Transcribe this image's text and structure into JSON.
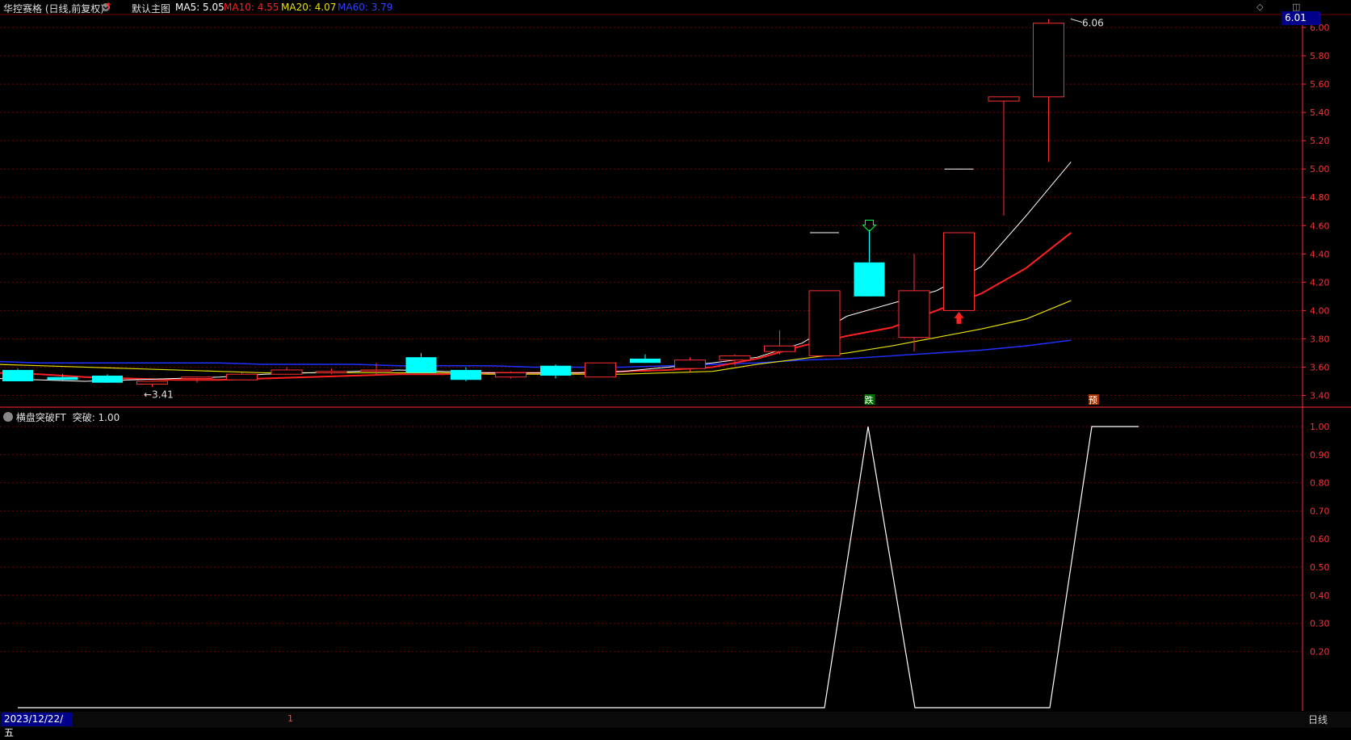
{
  "header": {
    "stock_name": "华控赛格 (日线,前复权)",
    "template_name": "默认主图",
    "ma_labels": [
      {
        "text": "MA5: 5.05",
        "color": "#ffffff"
      },
      {
        "text": "MA10: 4.55",
        "color": "#ff2020"
      },
      {
        "text": "MA20: 4.07",
        "color": "#e8e000"
      },
      {
        "text": "MA60: 3.79",
        "color": "#3040ff"
      }
    ]
  },
  "price_axis": {
    "ticks": [
      "6.00",
      "5.80",
      "5.60",
      "5.40",
      "5.20",
      "5.00",
      "4.80",
      "4.60",
      "4.40",
      "4.20",
      "4.00",
      "3.80",
      "3.60",
      "3.40"
    ],
    "tick_values": [
      6.0,
      5.8,
      5.6,
      5.4,
      5.2,
      5.0,
      4.8,
      4.6,
      4.4,
      4.2,
      4.0,
      3.8,
      3.6,
      3.4
    ],
    "current_price": "6.01"
  },
  "annotations": {
    "low_label": "←3.41",
    "high_label": "6.06",
    "signal_down_text": "跌",
    "signal_up_text": "预"
  },
  "indicator": {
    "title": "横盘突破FT",
    "value_label": "突破: 1.00",
    "ticks": [
      "1.00",
      "0.90",
      "0.80",
      "0.70",
      "0.60",
      "0.50",
      "0.40",
      "0.30",
      "0.20"
    ],
    "tick_values": [
      1.0,
      0.9,
      0.8,
      0.7,
      0.6,
      0.5,
      0.4,
      0.3,
      0.2
    ]
  },
  "footer": {
    "date": "2023/12/22/五",
    "marker": "1",
    "period": "日线"
  },
  "colors": {
    "up": "#ff3030",
    "down": "#00ffff",
    "grid": "#7a0000",
    "ma5": "#ffffff",
    "ma10": "#ff2020",
    "ma20": "#e8e000",
    "ma60": "#2030ff"
  },
  "chart_data": {
    "type": "candlestick",
    "candles": [
      {
        "o": 3.58,
        "h": 3.59,
        "l": 3.5,
        "c": 3.5
      },
      {
        "o": 3.53,
        "h": 3.55,
        "l": 3.5,
        "c": 3.51
      },
      {
        "o": 3.54,
        "h": 3.55,
        "l": 3.49,
        "c": 3.49
      },
      {
        "o": 3.48,
        "h": 3.5,
        "l": 3.46,
        "c": 3.5
      },
      {
        "o": 3.52,
        "h": 3.53,
        "l": 3.49,
        "c": 3.53
      },
      {
        "o": 3.51,
        "h": 3.56,
        "l": 3.51,
        "c": 3.55
      },
      {
        "o": 3.55,
        "h": 3.6,
        "l": 3.55,
        "c": 3.58
      },
      {
        "o": 3.56,
        "h": 3.59,
        "l": 3.55,
        "c": 3.57
      },
      {
        "o": 3.58,
        "h": 3.63,
        "l": 3.55,
        "c": 3.58
      },
      {
        "o": 3.67,
        "h": 3.7,
        "l": 3.56,
        "c": 3.56
      },
      {
        "o": 3.58,
        "h": 3.6,
        "l": 3.5,
        "c": 3.51
      },
      {
        "o": 3.53,
        "h": 3.57,
        "l": 3.52,
        "c": 3.56
      },
      {
        "o": 3.61,
        "h": 3.62,
        "l": 3.52,
        "c": 3.54
      },
      {
        "o": 3.53,
        "h": 3.63,
        "l": 3.53,
        "c": 3.63
      },
      {
        "o": 3.66,
        "h": 3.69,
        "l": 3.63,
        "c": 3.63
      },
      {
        "o": 3.59,
        "h": 3.67,
        "l": 3.57,
        "c": 3.65
      },
      {
        "o": 3.65,
        "h": 3.69,
        "l": 3.61,
        "c": 3.68
      },
      {
        "o": 3.71,
        "h": 3.86,
        "l": 3.69,
        "c": 3.75
      },
      {
        "o": 3.68,
        "h": 4.14,
        "l": 3.68,
        "c": 4.14
      },
      {
        "o": 4.34,
        "h": 4.57,
        "l": 4.1,
        "c": 4.1
      },
      {
        "o": 3.81,
        "h": 4.4,
        "l": 3.71,
        "c": 4.14
      },
      {
        "o": 4.0,
        "h": 4.55,
        "l": 4.0,
        "c": 4.55
      },
      {
        "o": 5.48,
        "h": 5.51,
        "l": 4.67,
        "c": 5.51
      },
      {
        "o": 5.51,
        "h": 6.06,
        "l": 5.05,
        "c": 6.03
      }
    ],
    "ma5": [
      3.52,
      3.51,
      3.5,
      3.51,
      3.52,
      3.53,
      3.55,
      3.56,
      3.57,
      3.58,
      3.57,
      3.56,
      3.56,
      3.56,
      3.57,
      3.6,
      3.63,
      3.67,
      3.77,
      3.96,
      4.05,
      4.14,
      4.31,
      4.67,
      5.05
    ],
    "ma10": [
      3.56,
      3.55,
      3.53,
      3.52,
      3.51,
      3.51,
      3.52,
      3.53,
      3.54,
      3.55,
      3.55,
      3.56,
      3.56,
      3.56,
      3.57,
      3.58,
      3.6,
      3.66,
      3.75,
      3.82,
      3.88,
      4.0,
      4.12,
      4.3,
      4.55
    ],
    "ma20": [
      3.62,
      3.61,
      3.6,
      3.59,
      3.58,
      3.57,
      3.56,
      3.56,
      3.56,
      3.56,
      3.56,
      3.55,
      3.55,
      3.55,
      3.55,
      3.56,
      3.57,
      3.62,
      3.66,
      3.7,
      3.75,
      3.81,
      3.87,
      3.94,
      4.07
    ],
    "ma60": [
      3.64,
      3.63,
      3.63,
      3.63,
      3.63,
      3.63,
      3.62,
      3.62,
      3.62,
      3.61,
      3.61,
      3.61,
      3.6,
      3.6,
      3.6,
      3.61,
      3.62,
      3.63,
      3.65,
      3.66,
      3.68,
      3.7,
      3.72,
      3.75,
      3.79
    ],
    "ylim": [
      3.34,
      6.08
    ],
    "indicator_values": [
      0,
      0,
      0,
      0,
      0,
      0,
      0,
      0,
      0,
      0,
      0,
      0,
      0,
      0,
      0,
      0,
      0,
      0,
      0,
      1,
      0,
      0,
      0,
      0,
      1,
      1
    ],
    "indicator_ylim": [
      0,
      1.0
    ]
  }
}
